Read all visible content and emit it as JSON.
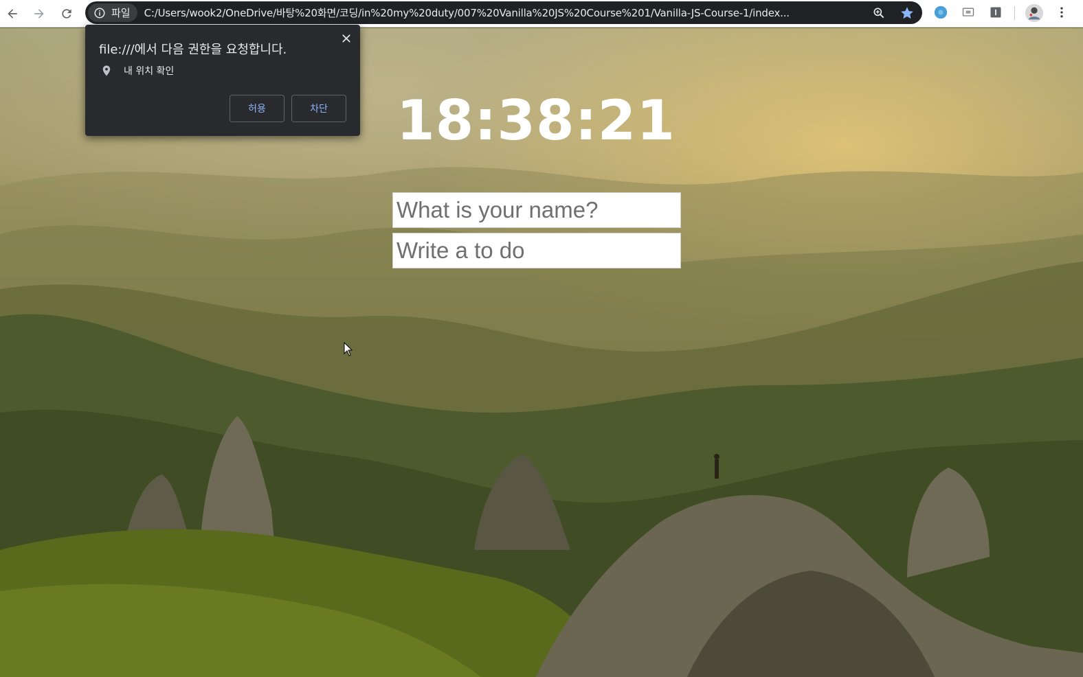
{
  "browser": {
    "site_chip_label": "파일",
    "url": "C:/Users/wook2/OneDrive/바탕%20화면/코딩/in%20my%20duty/007%20Vanilla%20JS%20Course%201/Vanilla-JS-Course-1/index...",
    "icons": [
      "back-icon",
      "forward-icon",
      "reload-icon",
      "info-icon",
      "zoom-icon",
      "star-icon",
      "extension-icon",
      "cast-icon",
      "reader-icon",
      "avatar",
      "menu-icon"
    ]
  },
  "permission_popup": {
    "title": "file:///에서 다음 권한을 요청합니다.",
    "permission_label": "내 위치 확인",
    "allow_label": "허용",
    "block_label": "차단"
  },
  "app": {
    "clock": "18:38:21",
    "name_placeholder": "What is your name?",
    "todo_placeholder": "Write a to do"
  }
}
